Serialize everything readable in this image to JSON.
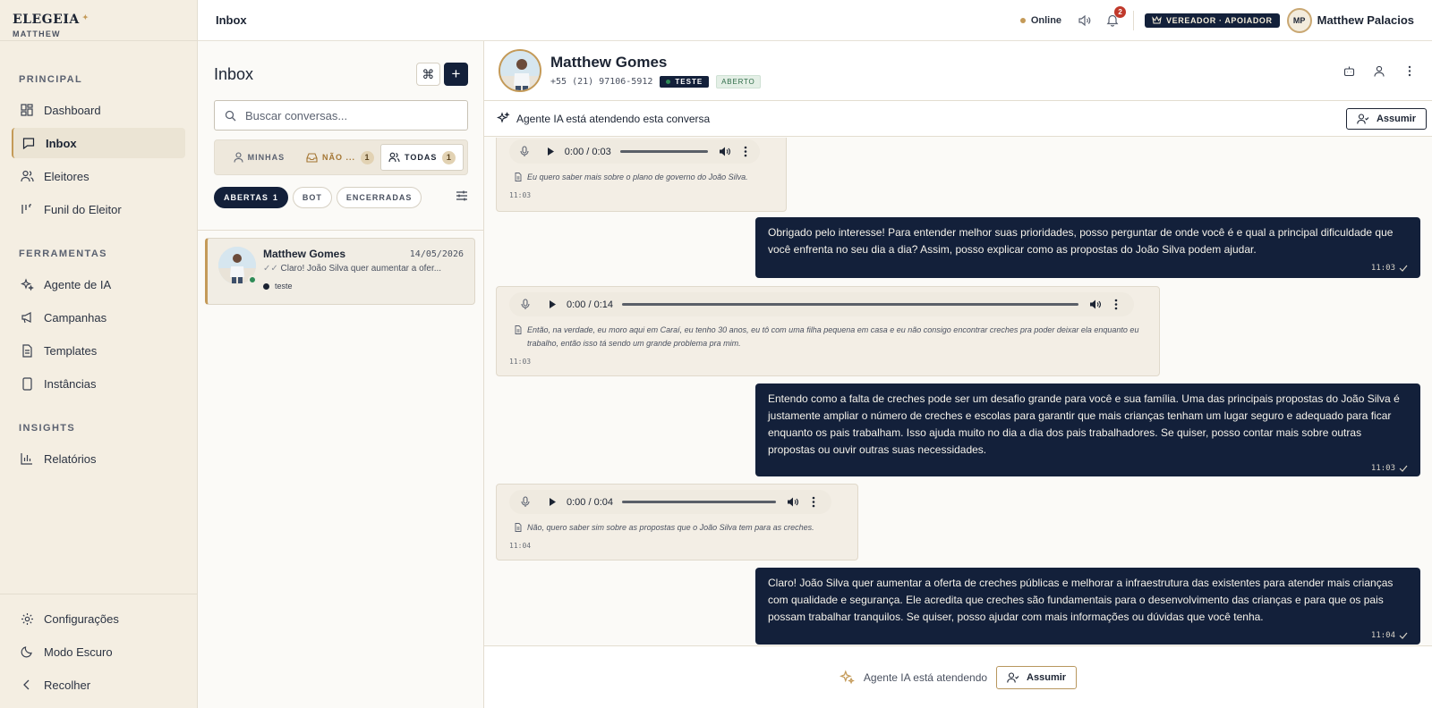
{
  "brand": {
    "logo": "ELEGEIA",
    "workspace": "MATTHEW"
  },
  "sidebar": {
    "sections": [
      {
        "heading": "PRINCIPAL",
        "items": [
          {
            "label": "Dashboard",
            "icon": "dashboard-icon"
          },
          {
            "label": "Inbox",
            "icon": "inbox-icon",
            "active": true
          },
          {
            "label": "Eleitores",
            "icon": "users-icon"
          },
          {
            "label": "Funil do Eleitor",
            "icon": "funnel-icon"
          }
        ]
      },
      {
        "heading": "FERRAMENTAS",
        "items": [
          {
            "label": "Agente de IA",
            "icon": "sparkles-icon"
          },
          {
            "label": "Campanhas",
            "icon": "megaphone-icon"
          },
          {
            "label": "Templates",
            "icon": "document-icon"
          },
          {
            "label": "Instâncias",
            "icon": "phone-icon"
          }
        ]
      },
      {
        "heading": "INSIGHTS",
        "items": [
          {
            "label": "Relatórios",
            "icon": "bar-chart-icon"
          }
        ]
      }
    ],
    "bottom": [
      {
        "label": "Configurações",
        "icon": "gear-icon"
      },
      {
        "label": "Modo Escuro",
        "icon": "moon-icon"
      },
      {
        "label": "Recolher",
        "icon": "chevron-left-icon"
      }
    ]
  },
  "topbar": {
    "breadcrumb": "Inbox",
    "status": "Online",
    "notifications": "2",
    "role": "VEREADOR · APOIADOR",
    "user_initials": "MP",
    "user_name": "Matthew Palacios"
  },
  "inbox": {
    "title": "Inbox",
    "search_placeholder": "Buscar conversas...",
    "tabs": [
      {
        "label": "MINHAS",
        "count": ""
      },
      {
        "label": "NÃO ...",
        "count": "1"
      },
      {
        "label": "TODAS",
        "count": "1",
        "active": true
      }
    ],
    "filters": [
      {
        "label": "ABERTAS",
        "count": "1",
        "active": true
      },
      {
        "label": "BOT",
        "count": ""
      },
      {
        "label": "ENCERRADAS",
        "count": ""
      }
    ],
    "conversations": [
      {
        "name": "Matthew Gomes",
        "date": "14/05/2026",
        "preview": "Claro! João Silva quer aumentar a ofer...",
        "tag": "teste"
      }
    ]
  },
  "chat": {
    "contact_name": "Matthew Gomes",
    "phone": "+55 (21) 97106-5912",
    "tag": "TESTE",
    "status": "ABERTO",
    "ai_banner": "Agente IA está atendendo esta conversa",
    "assume_label": "Assumir",
    "composer_text": "Agente IA está atendendo",
    "messages": [
      {
        "dir": "in",
        "audio_time": "0:00 / 0:03",
        "transcript": "Eu quero saber mais sobre o plano de governo do João Silva.",
        "time": "11:03"
      },
      {
        "dir": "out",
        "text": "Obrigado pelo interesse! Para entender melhor suas prioridades, posso perguntar de onde você é e qual a principal dificuldade que você enfrenta no seu dia a dia? Assim, posso explicar como as propostas do João Silva podem ajudar.",
        "time": "11:03"
      },
      {
        "dir": "in",
        "audio_time": "0:00 / 0:14",
        "transcript": "Então, na verdade, eu moro aqui em Caraí, eu tenho 30 anos, eu tô com uma filha pequena em casa e eu não consigo encontrar creches pra poder deixar ela enquanto eu trabalho, então isso tá sendo um grande problema pra mim.",
        "time": "11:03"
      },
      {
        "dir": "out",
        "text": "Entendo como a falta de creches pode ser um desafio grande para você e sua família. Uma das principais propostas do João Silva é justamente ampliar o número de creches e escolas para garantir que mais crianças tenham um lugar seguro e adequado para ficar enquanto os pais trabalham. Isso ajuda muito no dia a dia dos pais trabalhadores. Se quiser, posso contar mais sobre outras propostas ou ouvir outras suas necessidades.",
        "time": "11:03"
      },
      {
        "dir": "in",
        "audio_time": "0:00 / 0:04",
        "transcript": "Não, quero saber sim sobre as propostas que o João Silva tem para as creches.",
        "time": "11:04"
      },
      {
        "dir": "out",
        "text": "Claro! João Silva quer aumentar a oferta de creches públicas e melhorar a infraestrutura das existentes para atender mais crianças com qualidade e segurança. Ele acredita que creches são fundamentais para o desenvolvimento das crianças e para que os pais possam trabalhar tranquilos. Se quiser, posso ajudar com mais informações ou dúvidas que você tenha.",
        "time": "11:04"
      }
    ]
  }
}
